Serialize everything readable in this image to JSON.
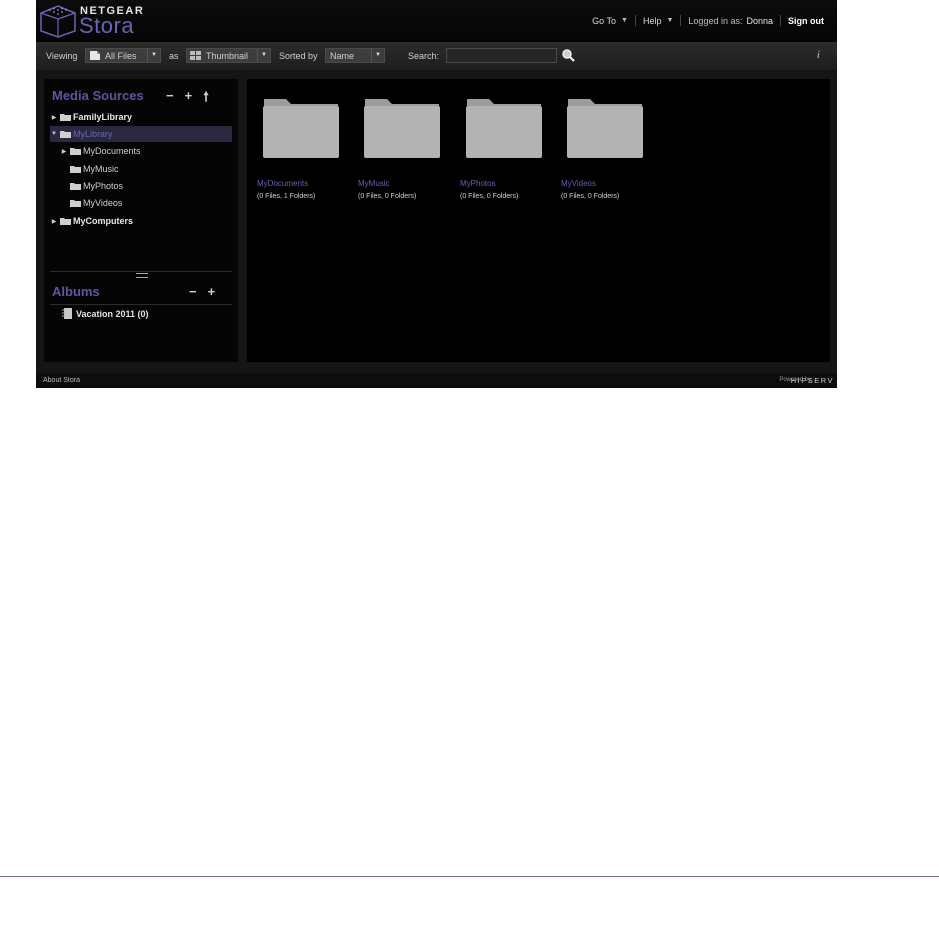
{
  "brand": {
    "top": "NETGEAR",
    "name": "Stora"
  },
  "nav": {
    "goto": "Go To",
    "help": "Help",
    "logged_in_label": "Logged in as:",
    "user": "Donna",
    "signout": "Sign out"
  },
  "toolbar": {
    "viewing_label": "Viewing",
    "viewing_value": "All Files",
    "as_label": "as",
    "view_mode": "Thumbnail",
    "sorted_label": "Sorted by",
    "sort_value": "Name",
    "search_label": "Search:",
    "search_value": "",
    "info": "i"
  },
  "sidebar": {
    "media_title": "Media Sources",
    "media_actions": [
      "−",
      "+",
      "🠕"
    ],
    "tree": [
      {
        "label": "FamilyLibrary",
        "arrow": "▶",
        "bold": true
      },
      {
        "label": "MyLibrary",
        "arrow": "▼",
        "selected": true
      },
      {
        "label": "MyDocuments",
        "arrow": "▶"
      },
      {
        "label": "MyMusic"
      },
      {
        "label": "MyPhotos"
      },
      {
        "label": "MyVideos"
      },
      {
        "label": "MyComputers",
        "arrow": "▶",
        "bold": true
      }
    ],
    "albums_title": "Albums",
    "album_actions": [
      "−",
      "+"
    ],
    "albums": [
      {
        "label": "Vacation 2011 (0)"
      }
    ]
  },
  "main": {
    "folders": [
      {
        "name": "MyDocuments",
        "meta": "(0 Files, 1 Folders)"
      },
      {
        "name": "MyMusic",
        "meta": "(0 Files, 0 Folders)"
      },
      {
        "name": "MyPhotos",
        "meta": "(0 Files, 0 Folders)"
      },
      {
        "name": "MyVideos",
        "meta": "(0 Files, 0 Folders)"
      }
    ]
  },
  "footer": {
    "about": "About Stora",
    "powered": "Powered by",
    "powered_brand": "HIPSERV"
  },
  "colors": {
    "accent": "#5a56a0",
    "selected_row": "#292840",
    "background": "#151515"
  }
}
